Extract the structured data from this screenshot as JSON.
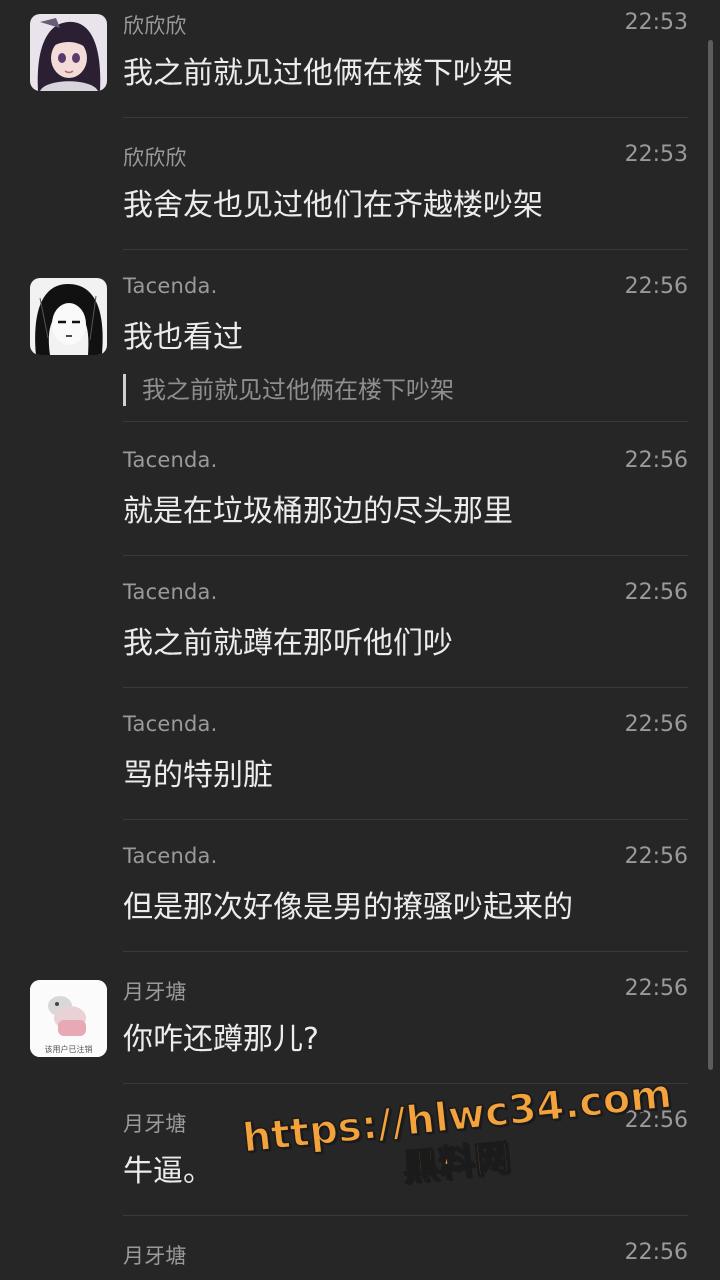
{
  "messages": [
    {
      "sender": "欣欣欣",
      "time": "22:53",
      "text": "我之前就见过他俩在楼下吵架",
      "avatar": "anime-girl-avatar"
    },
    {
      "sender": "欣欣欣",
      "time": "22:53",
      "text": "我舍友也见过他们在齐越楼吵架"
    },
    {
      "sender": "Tacenda.",
      "time": "22:56",
      "text": "我也看过",
      "quote": "我之前就见过他俩在楼下吵架",
      "avatar": "manga-avatar"
    },
    {
      "sender": "Tacenda.",
      "time": "22:56",
      "text": "就是在垃圾桶那边的尽头那里"
    },
    {
      "sender": "Tacenda.",
      "time": "22:56",
      "text": "我之前就蹲在那听他们吵"
    },
    {
      "sender": "Tacenda.",
      "time": "22:56",
      "text": "骂的特别脏"
    },
    {
      "sender": "Tacenda.",
      "time": "22:56",
      "text": "但是那次好像是男的撩骚吵起来的"
    },
    {
      "sender": "月牙塘",
      "time": "22:56",
      "text": "你咋还蹲那儿?",
      "avatar": "plush-toy-avatar",
      "avatar_caption": "该用户已注销"
    },
    {
      "sender": "月牙塘",
      "time": "22:56",
      "text": "牛逼。"
    },
    {
      "sender": "月牙塘",
      "time": "22:56",
      "text": ""
    }
  ],
  "watermark": {
    "url": "https://hlwc34.com",
    "subtitle": "黑料网"
  }
}
